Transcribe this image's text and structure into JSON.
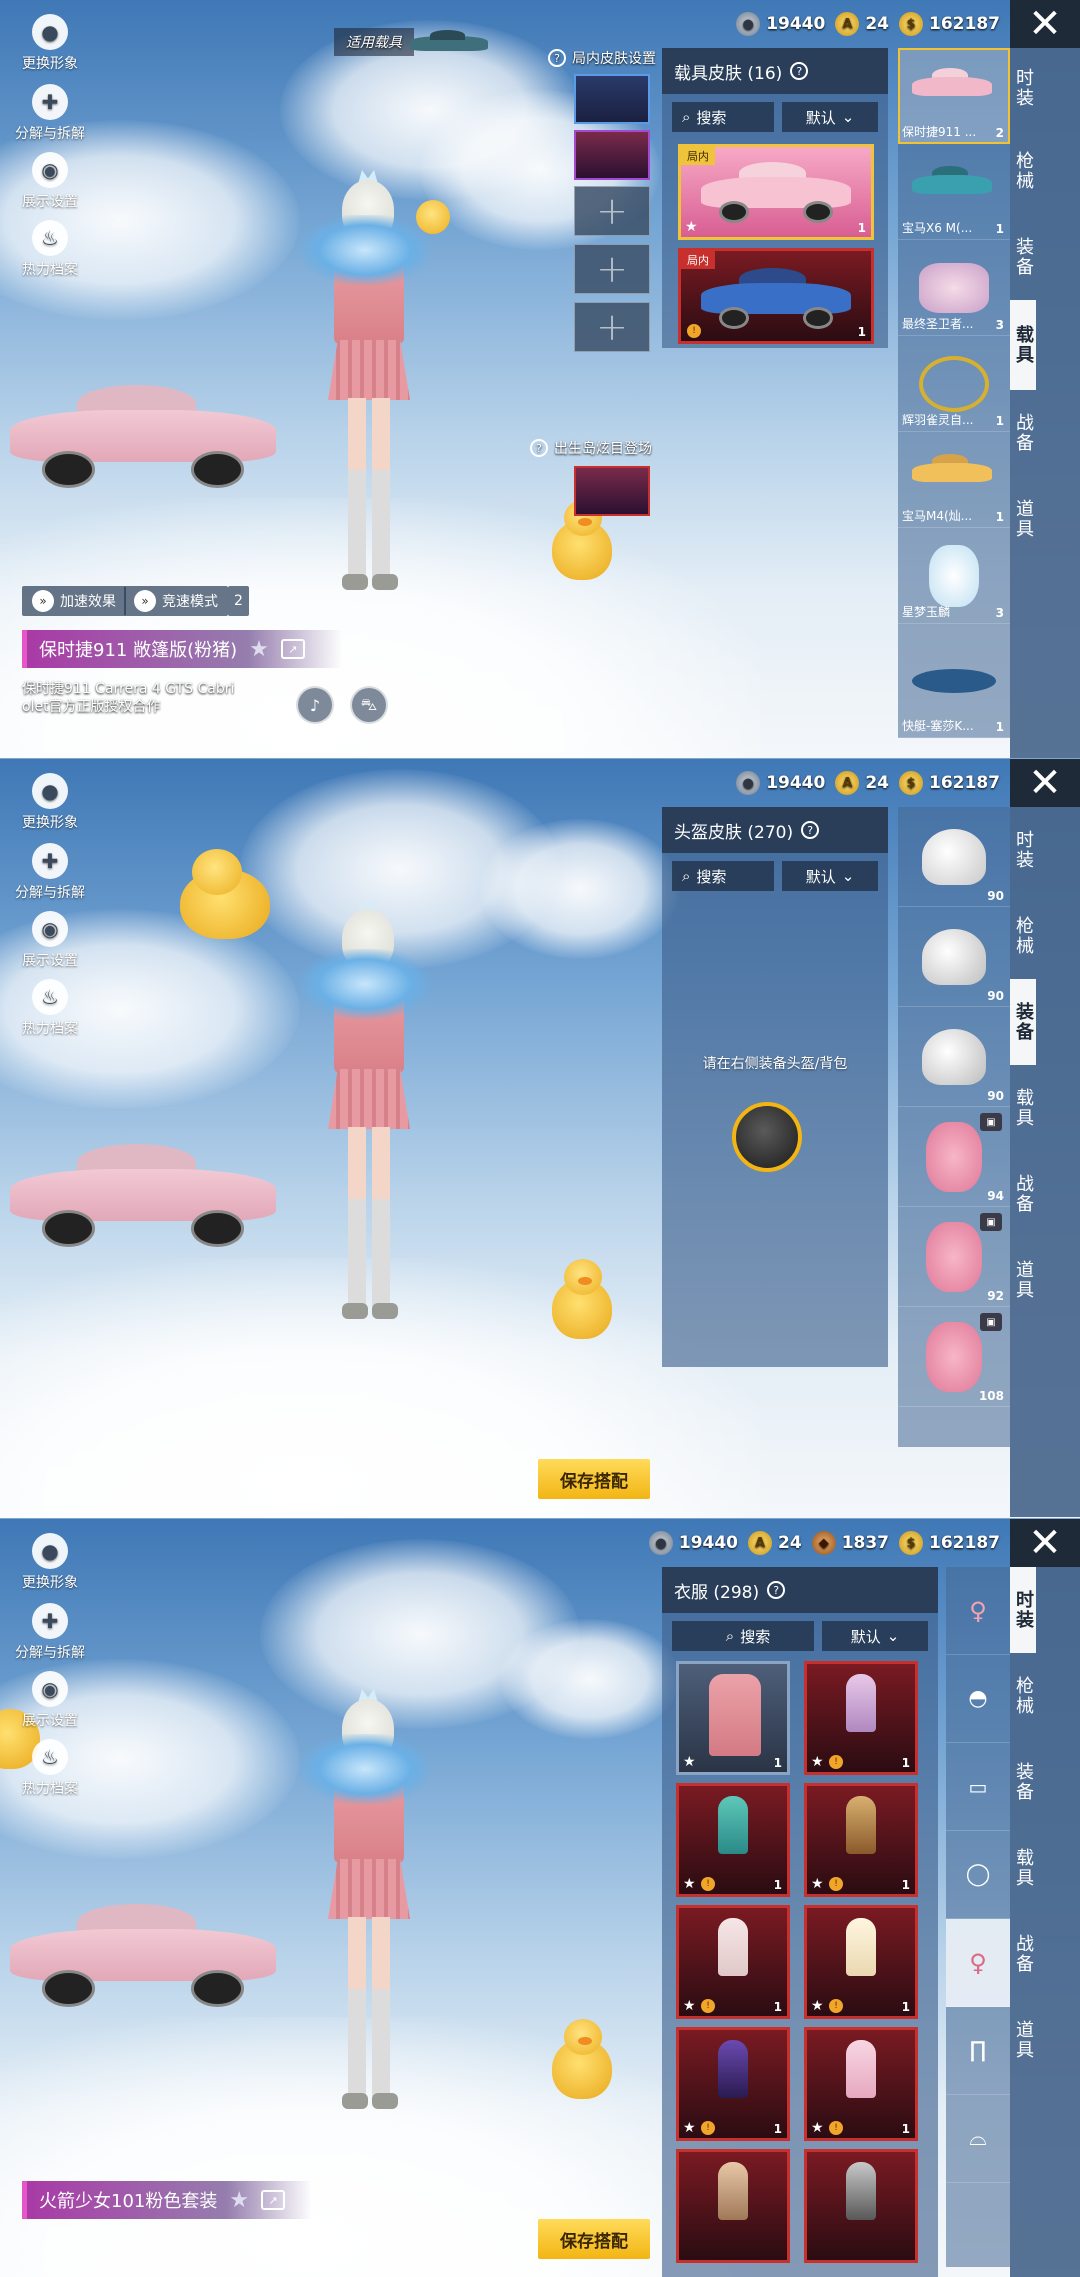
{
  "colors": {
    "gold": "#f1c232",
    "red": "#c7302c",
    "tab_active": "#f4f6f8",
    "save": "#f2b514"
  },
  "left_menu": [
    {
      "label": "更换形象",
      "icon": "avatar-icon"
    },
    {
      "label": "分解与拆解",
      "icon": "puzzle-icon"
    },
    {
      "label": "展示设置",
      "icon": "eye-icon"
    },
    {
      "label": "热力档案",
      "icon": "flame-icon"
    }
  ],
  "currency": {
    "silver": "19440",
    "gold": "24",
    "bronze": "1837",
    "uc": "162187"
  },
  "right_tabs": [
    "时装",
    "枪械",
    "装备",
    "载具",
    "战备",
    "道具"
  ],
  "p1": {
    "vehicle_label": "适用载具",
    "inner_skin_label": "局内皮肤设置",
    "spawn_label": "出生岛炫目登场",
    "panel_title": "载具皮肤 (16)",
    "search": "搜索",
    "sort": "默认",
    "card1_tag": "局内",
    "card1_num": "1",
    "card2_tag": "局内",
    "card2_num": "1",
    "accel_label": "加速效果",
    "racing_label": "竞速模式",
    "small_num": "2",
    "outfit_name": "保时捷911 敞篷版(粉猪)",
    "desc_line1": "保时捷911 Carrera 4 GTS Cabri",
    "desc_line2": "olet官方正版授权合作",
    "items": [
      {
        "name": "保时捷911 ...",
        "num": "2"
      },
      {
        "name": "宝马X6 M(...",
        "num": "1"
      },
      {
        "name": "最终圣卫者...",
        "num": "3"
      },
      {
        "name": "辉羽雀灵自...",
        "num": "1"
      },
      {
        "name": "宝马M4(灿...",
        "num": "1"
      },
      {
        "name": "星梦玉麟",
        "num": "3"
      },
      {
        "name": "快艇-塞莎K...",
        "num": "1"
      }
    ]
  },
  "p2": {
    "panel_title": "头盔皮肤 (270)",
    "search": "搜索",
    "sort": "默认",
    "hint": "请在右侧装备头盔/背包",
    "save": "保存搭配",
    "items": [
      "90",
      "90",
      "90",
      "94",
      "92",
      "108"
    ]
  },
  "p3": {
    "panel_title": "衣服 (298)",
    "search": "搜索",
    "sort": "默认",
    "outfit_name": "火箭少女101粉色套装",
    "save": "保存搭配",
    "cards": [
      "1",
      "1",
      "1",
      "1",
      "1",
      "1",
      "1",
      "1"
    ]
  }
}
